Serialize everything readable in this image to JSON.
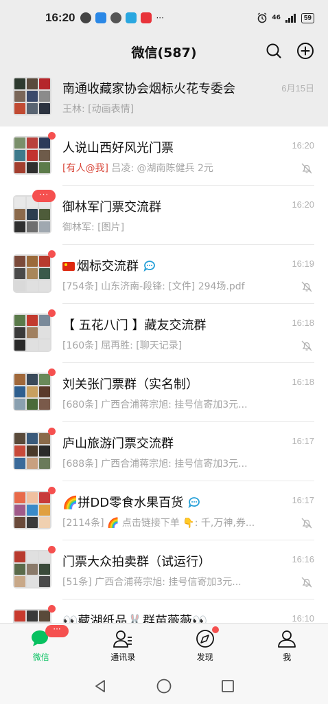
{
  "status_bar": {
    "time": "16:20",
    "dots": "···",
    "network": "46",
    "battery": "59"
  },
  "header": {
    "title": "微信(587)"
  },
  "chats": [
    {
      "name": "南通收藏家协会烟标火花专委会",
      "time": "6月15日",
      "preview": "王林: [动画表情]"
    },
    {
      "name": "人说山西好风光门票",
      "time": "16:20",
      "mention": "[有人@我]",
      "preview": " 吕凌: @湖南陈健兵 2元"
    },
    {
      "name": "御林军门票交流群",
      "time": "16:20",
      "preview": "御林军: [图片]",
      "badge": "···"
    },
    {
      "name": "烟标交流群",
      "time": "16:19",
      "preview": "[754条] 山东济南-段锋: [文件] 294场.pdf"
    },
    {
      "name": "【 五花八门 】藏友交流群",
      "time": "16:18",
      "preview": "[160条] 屈再胜: [聊天记录]"
    },
    {
      "name": "刘关张门票群（实名制）",
      "time": "16:18",
      "preview": "[680条] 广西合浦蒋宗旭: 挂号信寄加3元..."
    },
    {
      "name": "庐山旅游门票交流群",
      "time": "16:17",
      "preview": "[688条] 广西合浦蒋宗旭: 挂号信寄加3元..."
    },
    {
      "name": "🌈拼DD零食水果百货",
      "time": "16:17",
      "preview": "[2114条] 🌈 点击链接下单 👇: 千,万神,券..."
    },
    {
      "name": "门票大众拍卖群（试运行）",
      "time": "16:16",
      "preview": "[51条] 广西合浦蒋宗旭: 挂号信寄加3元..."
    },
    {
      "name": "👀藏湖纸品🐰群苗薇薇👀",
      "time": "16:10",
      "preview": ""
    }
  ],
  "tabs": [
    {
      "label": "微信",
      "badge": "···"
    },
    {
      "label": "通讯录"
    },
    {
      "label": "发现"
    },
    {
      "label": "我"
    }
  ],
  "colors": {
    "accent": "#07c160",
    "badge": "#f5504f",
    "muted": "#a6a6a6"
  },
  "icons": [
    "search-icon",
    "add-circle-icon",
    "mute-bell-icon",
    "chat-bubble-icon",
    "contacts-icon",
    "compass-icon",
    "person-icon",
    "back-icon",
    "home-icon",
    "recents-icon"
  ]
}
